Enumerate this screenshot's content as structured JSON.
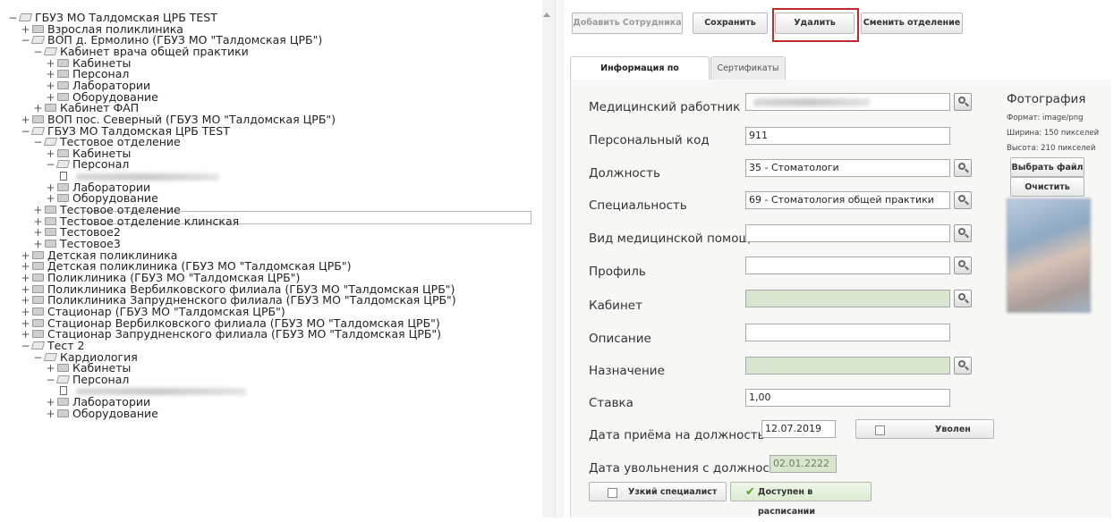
{
  "tree": {
    "nodes": [
      {
        "text": "ГБУЗ МО Талдомская ЦРБ TEST",
        "toggle": "−",
        "open": true
      },
      {
        "text": "Взрослая поликлиника",
        "toggle": "+",
        "open": false
      },
      {
        "text": "ВОП д. Ермолино (ГБУЗ МО \"Талдомская ЦРБ\")",
        "toggle": "−",
        "open": true
      },
      {
        "text": "Кабинет врача общей практики",
        "toggle": "−",
        "open": true
      },
      {
        "text": "Кабинеты",
        "toggle": "+",
        "open": false
      },
      {
        "text": "Персонал",
        "toggle": "+",
        "open": false
      },
      {
        "text": "Лаборатории",
        "toggle": "+",
        "open": false
      },
      {
        "text": "Оборудование",
        "toggle": "+",
        "open": false
      },
      {
        "text": "Кабинет ФАП",
        "toggle": "+",
        "open": false
      },
      {
        "text": "ВОП пос. Северный (ГБУЗ МО \"Талдомская ЦРБ\")",
        "toggle": "+",
        "open": false
      },
      {
        "text": "ГБУЗ МО Талдомская ЦРБ TEST",
        "toggle": "−",
        "open": true
      },
      {
        "text": "Тестовое отделение",
        "toggle": "−",
        "open": true
      },
      {
        "text": "Кабинеты",
        "toggle": "+",
        "open": false
      },
      {
        "text": "Персонал",
        "toggle": "−",
        "open": true
      },
      {
        "text": "",
        "toggle": "",
        "open": false
      },
      {
        "text": "Лаборатории",
        "toggle": "+",
        "open": false
      },
      {
        "text": "Оборудование",
        "toggle": "+",
        "open": false
      },
      {
        "text": "Тестовое отделение",
        "toggle": "+",
        "open": false
      },
      {
        "text": "Тестовое отделение клинская",
        "toggle": "+",
        "open": false
      },
      {
        "text": "Тестовое2",
        "toggle": "+",
        "open": false
      },
      {
        "text": "Тестовое3",
        "toggle": "+",
        "open": false
      },
      {
        "text": "Детская поликлиника",
        "toggle": "+",
        "open": false
      },
      {
        "text": "Детская поликлиника (ГБУЗ МО \"Талдомская ЦРБ\")",
        "toggle": "+",
        "open": false
      },
      {
        "text": "Поликлиника (ГБУЗ МО \"Талдомская ЦРБ\")",
        "toggle": "+",
        "open": false
      },
      {
        "text": "Поликлиника Вербилковского филиала (ГБУЗ МО \"Талдомская ЦРБ\")",
        "toggle": "+",
        "open": false
      },
      {
        "text": "Поликлиника Запрудненского филиала (ГБУЗ МО \"Талдомская ЦРБ\")",
        "toggle": "+",
        "open": false
      },
      {
        "text": "Стационар (ГБУЗ МО \"Талдомская ЦРБ\")",
        "toggle": "+",
        "open": false
      },
      {
        "text": "Стационар Вербилковского филиала (ГБУЗ МО \"Талдомская ЦРБ\")",
        "toggle": "+",
        "open": false
      },
      {
        "text": "Стационар Запрудненского филиала (ГБУЗ МО \"Талдомская ЦРБ\")",
        "toggle": "+",
        "open": false
      },
      {
        "text": "Тест 2",
        "toggle": "−",
        "open": true
      },
      {
        "text": "Кардиология",
        "toggle": "−",
        "open": true
      },
      {
        "text": "Кабинеты",
        "toggle": "+",
        "open": false
      },
      {
        "text": "Персонал",
        "toggle": "−",
        "open": true
      },
      {
        "text": "",
        "toggle": "",
        "open": false
      },
      {
        "text": "Лаборатории",
        "toggle": "+",
        "open": false
      },
      {
        "text": "Оборудование",
        "toggle": "+",
        "open": false
      }
    ]
  },
  "toolbar": {
    "add_label": "Добавить Сотрудника",
    "save_label": "Сохранить",
    "delete_label": "Удалить",
    "change_dept_label": "Сменить отделение"
  },
  "tabs": {
    "info_label": "Информация по сотруднику",
    "certs_label": "Сертификаты"
  },
  "form": {
    "med_worker_label": "Медицинский работник",
    "med_worker_value": "",
    "personal_code_label": "Персональный код",
    "personal_code_value": "911",
    "position_label": "Должность",
    "position_value": "35 - Стоматологи",
    "specialty_label": "Специальность",
    "specialty_value": "69 - Стоматология общей практики",
    "care_type_label": "Вид медицинской помощи",
    "care_type_value": "",
    "profile_label": "Профиль",
    "profile_value": "",
    "cabinet_label": "Кабинет",
    "cabinet_value": "",
    "description_label": "Описание",
    "description_value": "",
    "purpose_label": "Назначение",
    "purpose_value": "",
    "rate_label": "Ставка",
    "rate_value": "1,00",
    "hire_date_label": "Дата приёма на должность",
    "hire_date_value": "12.07.2019",
    "dismissed_label": "Уволен",
    "dismiss_date_label": "Дата увольнения с должности",
    "dismiss_date_value": "02.01.2222",
    "narrow_specialist_label": "Узкий специалист",
    "schedule_available_label": "Доступен в расписании"
  },
  "photo": {
    "title": "Фотография",
    "format": "Формат: image/png",
    "width": "Ширина: 150 пикселей",
    "height": "Высота: 210 пикселей",
    "choose_file_label": "Выбрать файл",
    "clear_photo_label": "Очистить фото"
  },
  "colors": {
    "highlight_border": "#c1272d",
    "readonly_field": "#d9e6cf",
    "check_green": "#5aa02c"
  }
}
